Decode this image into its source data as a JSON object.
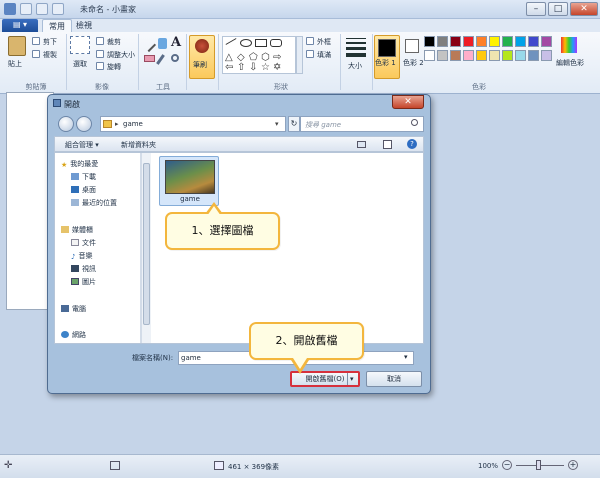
{
  "window": {
    "title": "未命名 - 小畫家",
    "minimize_glyph": "–",
    "maximize_glyph": "□",
    "close_glyph": "✕"
  },
  "tabs": {
    "file_menu_glyph": "▤ ▾",
    "home": "常用",
    "view": "檢視"
  },
  "ribbon": {
    "clipboard": {
      "paste": "貼上",
      "cut": "剪下",
      "copy": "複製",
      "label": "剪貼簿"
    },
    "image": {
      "select": "選取",
      "crop": "裁剪",
      "resize": "調整大小",
      "rotate": "旋轉",
      "label": "影像"
    },
    "tools": {
      "label": "工具"
    },
    "brushes": {
      "label": "筆刷"
    },
    "shapes": {
      "outline": "外框",
      "fill": "填滿",
      "label": "形狀"
    },
    "size": {
      "label": "大小"
    },
    "colors": {
      "color1": "色彩 1",
      "color2": "色彩 2",
      "edit": "編輯色彩",
      "label": "色彩",
      "palette": [
        "#000000",
        "#7f7f7f",
        "#880015",
        "#ed1c24",
        "#ff7f27",
        "#fff200",
        "#22b14c",
        "#00a2e8",
        "#3f48cc",
        "#a349a4",
        "#ffffff",
        "#c3c3c3",
        "#b97a57",
        "#ffaec9",
        "#ffc90e",
        "#efe4b0",
        "#b5e61d",
        "#99d9ea",
        "#7092be",
        "#c8bfe7"
      ]
    }
  },
  "dialog": {
    "title": "開啟",
    "close_glyph": "✕",
    "address": "game",
    "search_placeholder": "搜尋 game",
    "toolbar": {
      "organize": "組合管理 ▾",
      "new_folder": "新增資料夾"
    },
    "nav": {
      "favorites": "我的最愛",
      "downloads": "下載",
      "desktop": "桌面",
      "recent": "最近的位置",
      "libraries": "媒體櫃",
      "documents": "文件",
      "music": "音樂",
      "videos": "視訊",
      "pictures": "圖片",
      "computer": "電腦",
      "network": "網路"
    },
    "file": {
      "name": "game"
    },
    "filename_label": "檔案名稱(N):",
    "filename_value": "game",
    "open_label": "開啟舊檔(O)",
    "cancel_label": "取消"
  },
  "callouts": {
    "step1": "1、選擇圖檔",
    "step2": "2、開啟舊檔"
  },
  "status": {
    "dimensions": "461 × 369像素",
    "zoom": "100%"
  }
}
